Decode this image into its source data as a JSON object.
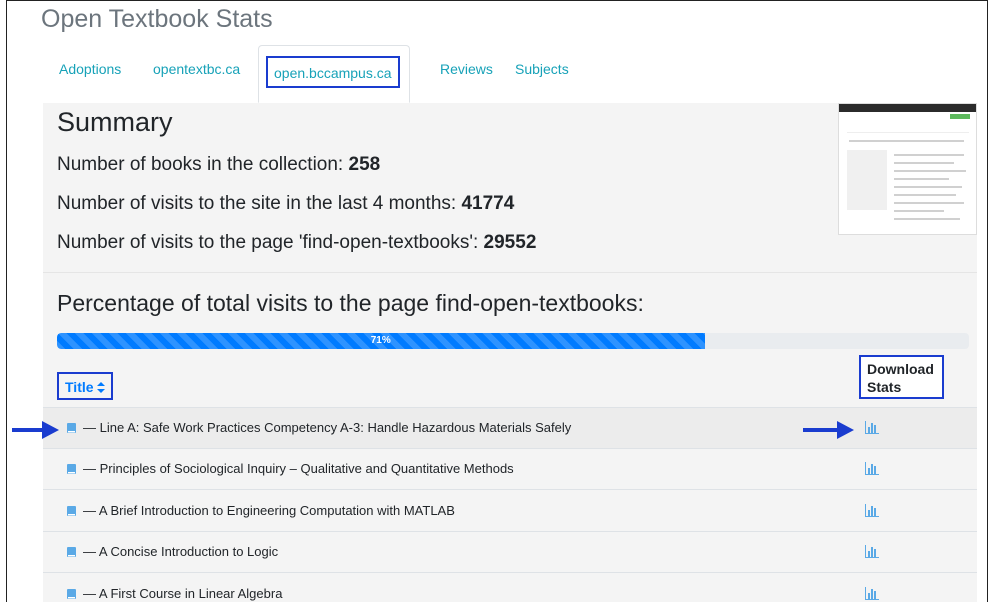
{
  "app": {
    "title": "Open Textbook Stats"
  },
  "tabs": [
    {
      "label": "Adoptions"
    },
    {
      "label": "opentextbc.ca"
    },
    {
      "label": "open.bccampus.ca"
    },
    {
      "label": "Reviews"
    },
    {
      "label": "Subjects"
    }
  ],
  "active_tab": "open.bccampus.ca",
  "summary": {
    "heading": "Summary",
    "stats": [
      {
        "label": "Number of books in the collection:",
        "value": "258"
      },
      {
        "label": "Number of visits to the site in the last 4 months:",
        "value": "41774"
      },
      {
        "label": "Number of visits to the page 'find-open-textbooks':",
        "value": "29552"
      }
    ]
  },
  "percentage": {
    "heading": "Percentage of total visits to the page find-open-textbooks:",
    "label": "71%",
    "value": 71
  },
  "table": {
    "title_header": "Title",
    "sort_icon": "sort-icon",
    "download_header": "Download Stats",
    "rows": [
      {
        "title": "— Line A: Safe Work Practices Competency A-3: Handle Hazardous Materials Safely"
      },
      {
        "title": "— Principles of Sociological Inquiry – Qualitative and Quantitative Methods"
      },
      {
        "title": "— A Brief Introduction to Engineering Computation with MATLAB"
      },
      {
        "title": "— A Concise Introduction to Logic"
      },
      {
        "title": "— A First Course in Linear Algebra"
      }
    ]
  },
  "colors": {
    "accent": "#007bff",
    "tab_link": "#17a2b8",
    "highlight_box": "#1a3ccf",
    "arrow": "#1a3ccf"
  },
  "icons": {
    "book": "book-icon",
    "chart": "bar-chart-icon",
    "arrow": "arrow-right-icon"
  }
}
